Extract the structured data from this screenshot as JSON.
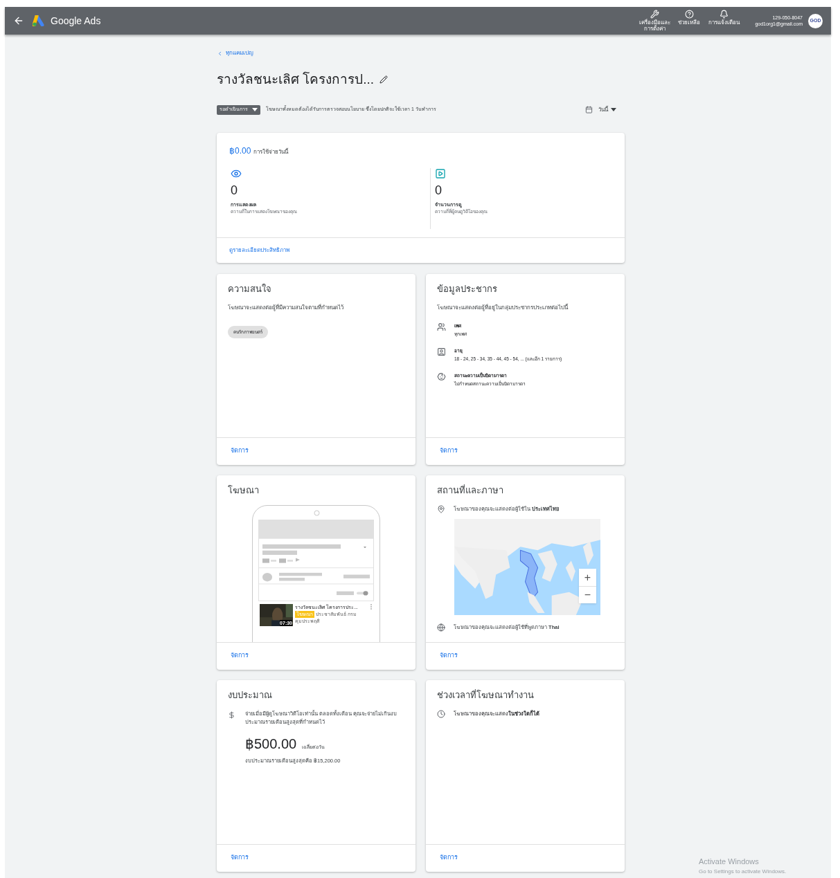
{
  "top_bar": {
    "app_name": "Google Ads",
    "tools": [
      {
        "kind": "wrench",
        "label": "เครื่องมือและการตั้งค่า"
      },
      {
        "kind": "help",
        "label": "ช่วยเหลือ"
      },
      {
        "kind": "bell",
        "label": "การแจ้งเตือน"
      }
    ],
    "account": {
      "id": "129-050-8047",
      "email": "god1org1@gmail.com",
      "avatar": "GOD"
    }
  },
  "breadcrumb": "ทุกแคมเปญ",
  "campaign_title": "รางวัลชนะเลิศ โครงการป...",
  "status": {
    "label": "รอดำเนินการ",
    "message": "โฆษณาทั้งหมดต้องได้รับการตรวจสอบนโยบาย ซึ่งโดยปกติจะใช้เวลา 1 วันทำการ"
  },
  "date_range": "วันนี้",
  "summary": {
    "cost": "฿0.00",
    "cost_label": "การใช้จ่ายวันนี้",
    "metrics": [
      {
        "kind": "impressions",
        "value": "0",
        "label": "การแสดงผล",
        "description": "ความถี่ในการแสดงโฆษณาของคุณ"
      },
      {
        "kind": "views",
        "value": "0",
        "label": "จำนวนการดู",
        "description": "ความถี่ที่ผู้คนดูวิดีโอของคุณ"
      }
    ],
    "link": "ดูรายละเอียดประสิทธิภาพ"
  },
  "interests": {
    "title": "ความสนใจ",
    "description": "โฆษณาจะแสดงต่อผู้ที่มีความสนใจตามที่กำหนดไว้",
    "chips": [
      "คนรักภาพยนตร์"
    ],
    "manage": "จัดการ"
  },
  "demographics": {
    "title": "ข้อมูลประชากร",
    "description": "โฆษณาจะแสดงต่อผู้ที่อยู่ในกลุ่มประชากรประเภทต่อไปนี้",
    "items": [
      {
        "kind": "gender",
        "label": "เพศ",
        "value": "ทุกเพศ"
      },
      {
        "kind": "age",
        "label": "อายุ",
        "value": "18 - 24, 25 - 34, 35 - 44, 45 - 54, ... (และอีก 1 รายการ)"
      },
      {
        "kind": "parental",
        "label": "สถานะความเป็นบิดามารดา",
        "value": "ไม่กำหนดสถานะความเป็นบิดามารดา"
      }
    ],
    "manage": "จัดการ"
  },
  "ad": {
    "title": "โฆษณา",
    "video": {
      "title": "รางวัลชนะเลิศ โครงการประ...",
      "badge": "โฆษณา",
      "channel": "ประชาสัมพันธ์ กรม",
      "channel_2": "คุมประพฤติ",
      "duration": "07:30"
    },
    "manage": "จัดการ"
  },
  "location": {
    "title": "สถานที่และภาษา",
    "location_text": "โฆษณาของคุณจะแสดงต่อผู้ใช้ใน **ประเทศไทย**",
    "zoom_in": "+",
    "zoom_out": "−",
    "language_text": "โฆษณาของคุณจะแสดงต่อผู้ใช้ที่พูดภาษา **Thai**",
    "manage": "จัดการ"
  },
  "budget": {
    "title": "งบประมาณ",
    "description": "จ่ายเมื่อมีผู้ดูโฆษณาวิดีโอเท่านั้น ตลอดทั้งเดือน คุณจะจ่ายไม่เกินงบประมาณรายเดือนสูงสุดที่กำหนดไว้",
    "amount": "฿500.00",
    "amount_label": "เฉลี่ยต่อวัน",
    "monthly": "งบประมาณรายเดือนสูงสุดคือ ฿15,200.00",
    "manage": "จัดการ"
  },
  "schedule": {
    "title": "ช่วงเวลาที่โฆษณาทำงาน",
    "text": "โฆษณาของคุณจะแสดง**ในช่วงใดก็ได้**",
    "manage": "จัดการ"
  },
  "os_notice": {
    "title": "Activate Windows",
    "text": "Go to Settings to activate Windows."
  }
}
